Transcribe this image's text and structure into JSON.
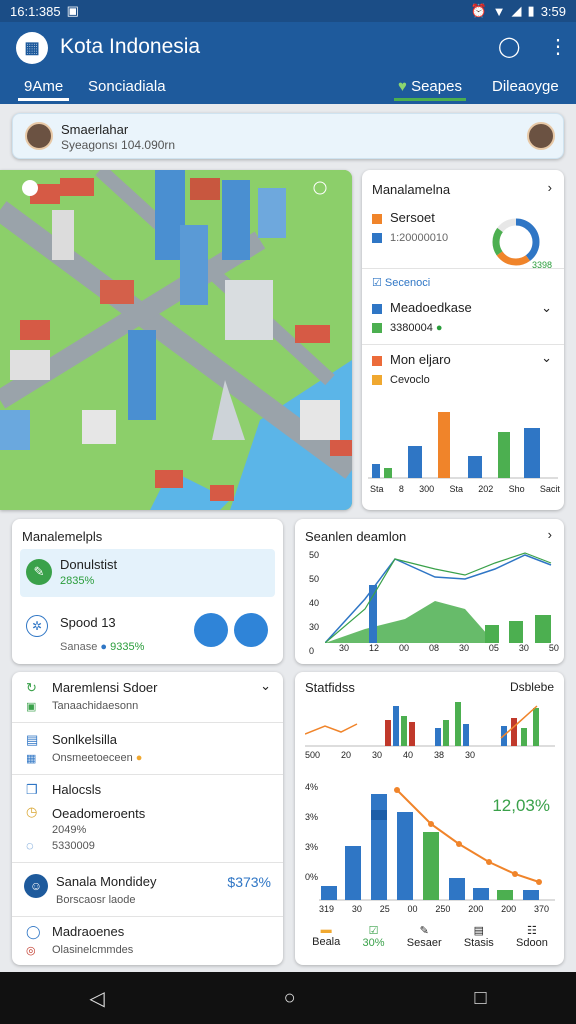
{
  "status": {
    "time": "16:1:385",
    "right_time": "3:59"
  },
  "app": {
    "title": "Kota Indonesia"
  },
  "tabs": [
    {
      "label": "9Ame"
    },
    {
      "label": "Sonciadiala"
    },
    {
      "label": "Seapes"
    },
    {
      "label": "Dileaoyge"
    }
  ],
  "profile": {
    "name": "Smaerlahar",
    "subtitle": "Syeagonsı 104.090rn"
  },
  "side_panel": {
    "title": "Manalamelna",
    "items": [
      {
        "label": "Sersoet",
        "value": "1:20000010"
      },
      {
        "label": "Secenoci"
      },
      {
        "label": "Meadoedkase",
        "value": "3380004"
      },
      {
        "label": "Mon eljaro",
        "value": "Cevoclo"
      }
    ],
    "donut_label": "3398",
    "axis": [
      "Sta",
      "8",
      "300",
      "Sta",
      "202",
      "Sho",
      "Sacit"
    ]
  },
  "mid_left": {
    "title": "Manalemelpls",
    "item1": {
      "label": "Donulstist",
      "value": "2835%"
    },
    "item2": {
      "label": "Spood 13",
      "sub": "Sanase",
      "value": "9335%"
    }
  },
  "mid_right": {
    "title": "Seanlen deamlon",
    "y_ticks": [
      "50",
      "50",
      "40",
      "30",
      "0"
    ],
    "x_ticks": [
      "30",
      "12",
      "00",
      "08",
      "30",
      "05",
      "30",
      "50"
    ]
  },
  "list": {
    "items": [
      {
        "label": "Maremlensi Sdoer",
        "sub": "Tanaachidaesonn"
      },
      {
        "label": "Sonlkelsilla",
        "sub": "Onsmeetoeceen"
      },
      {
        "label": "Halocsls"
      },
      {
        "label": "Oeadomeroents",
        "sub": "2049%",
        "sub2": "5330009"
      },
      {
        "label": "Sanala Mondidey",
        "sub": "Borscaosr laode",
        "value": "$373%"
      },
      {
        "label": "Madraoenes",
        "sub": "Olasinelcmmdes"
      }
    ]
  },
  "stats": {
    "title": "Statfidss",
    "right": "Dsblebe",
    "small_x": [
      "500",
      "20",
      "30",
      "40",
      "38",
      "30"
    ],
    "big_y": [
      "4%",
      "3%",
      "3%",
      "0%"
    ],
    "big_x": [
      "319",
      "30",
      "25",
      "00",
      "250",
      "200",
      "200",
      "370"
    ],
    "kpi": "12,03%",
    "tabs": [
      {
        "label": "Beala"
      },
      {
        "label": "30%"
      },
      {
        "label": "Sesaer"
      },
      {
        "label": "Stasis"
      },
      {
        "label": "Sdoon"
      }
    ]
  }
}
